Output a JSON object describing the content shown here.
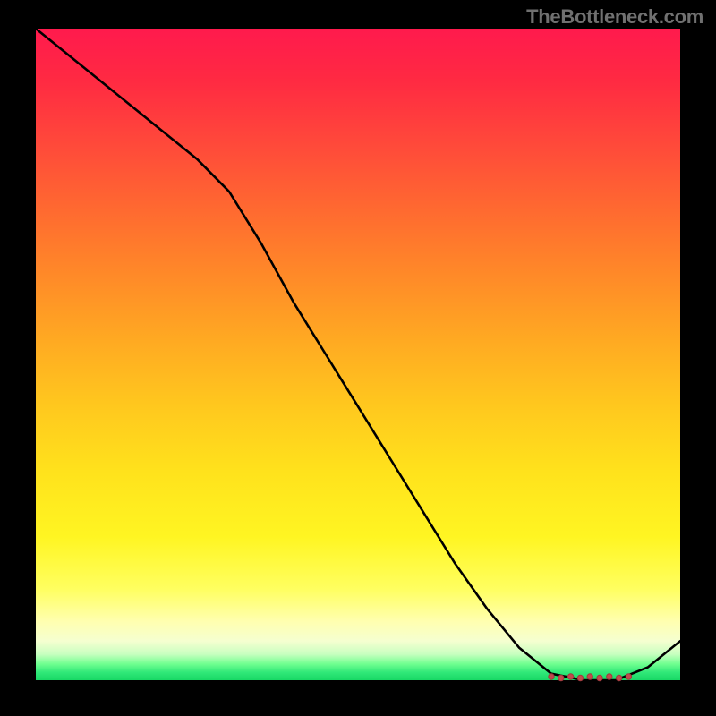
{
  "watermark": "TheBottleneck.com",
  "colors": {
    "background": "#000000",
    "line": "#000000",
    "marker_fill": "#c24a4d",
    "marker_stroke": "#a03a3d"
  },
  "chart_data": {
    "type": "line",
    "title": "",
    "xlabel": "",
    "ylabel": "",
    "xlim": [
      0,
      100
    ],
    "ylim": [
      0,
      100
    ],
    "x": [
      0,
      5,
      10,
      15,
      20,
      25,
      30,
      35,
      40,
      45,
      50,
      55,
      60,
      65,
      70,
      75,
      80,
      85,
      90,
      95,
      100
    ],
    "y": [
      100,
      96,
      92,
      88,
      84,
      80,
      75,
      67,
      58,
      50,
      42,
      34,
      26,
      18,
      11,
      5,
      1,
      0,
      0,
      2,
      6
    ],
    "marker_band": {
      "x_range": [
        80,
        92
      ],
      "y": 0,
      "note": "cluster of small markers along the minimum plateau"
    },
    "gradient_stops_top_to_bottom": [
      "#ff1a4d",
      "#ff6a30",
      "#ffaa22",
      "#ffe21c",
      "#ffffb0",
      "#70ff90",
      "#18d865"
    ]
  }
}
